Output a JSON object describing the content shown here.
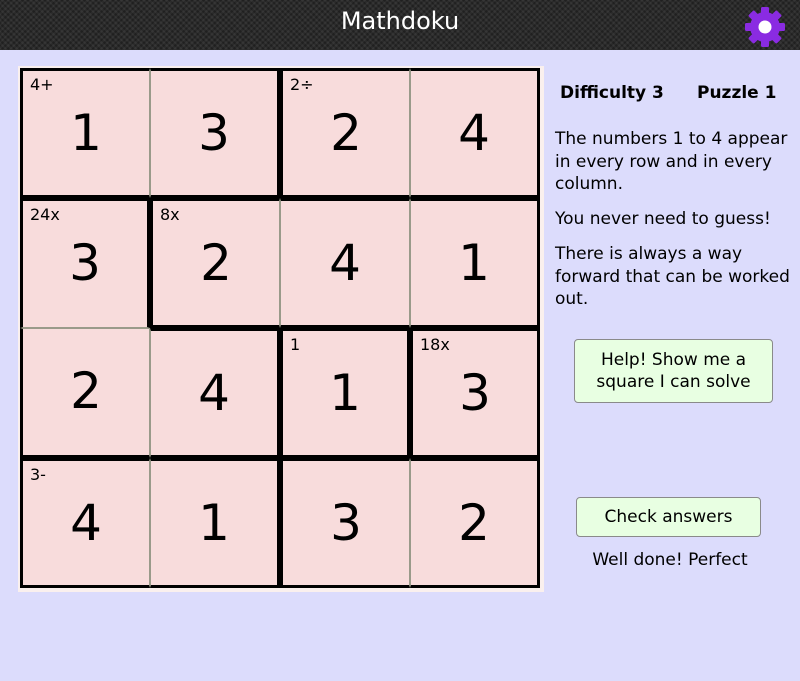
{
  "header": {
    "title": "Mathdoku",
    "settings_icon": "gear-icon",
    "accent": "#8a2be2"
  },
  "info": {
    "difficulty": "Difficulty 3",
    "puzzle": "Puzzle 1",
    "paragraphs": [
      "The numbers 1 to 4 appear in every row and in every column.",
      "You never need to guess!",
      "There is always a way forward that can be worked out."
    ]
  },
  "buttons": {
    "help": "Help! Show me a square I can solve",
    "check": "Check answers"
  },
  "status": "Well done! Perfect",
  "grid": {
    "values": [
      [
        1,
        3,
        2,
        4
      ],
      [
        3,
        2,
        4,
        1
      ],
      [
        2,
        4,
        1,
        3
      ],
      [
        4,
        1,
        3,
        2
      ]
    ],
    "clues": [
      [
        "4+",
        "",
        "2÷",
        ""
      ],
      [
        "24x",
        "8x",
        "",
        ""
      ],
      [
        "",
        "",
        "1",
        "18x"
      ],
      [
        "3-",
        "",
        "",
        ""
      ]
    ],
    "cages": [
      [
        "A",
        "A",
        "B",
        "B"
      ],
      [
        "C",
        "D",
        "D",
        "D"
      ],
      [
        "C",
        "C",
        "E",
        "F"
      ],
      [
        "G",
        "G",
        "H",
        "H"
      ]
    ]
  }
}
